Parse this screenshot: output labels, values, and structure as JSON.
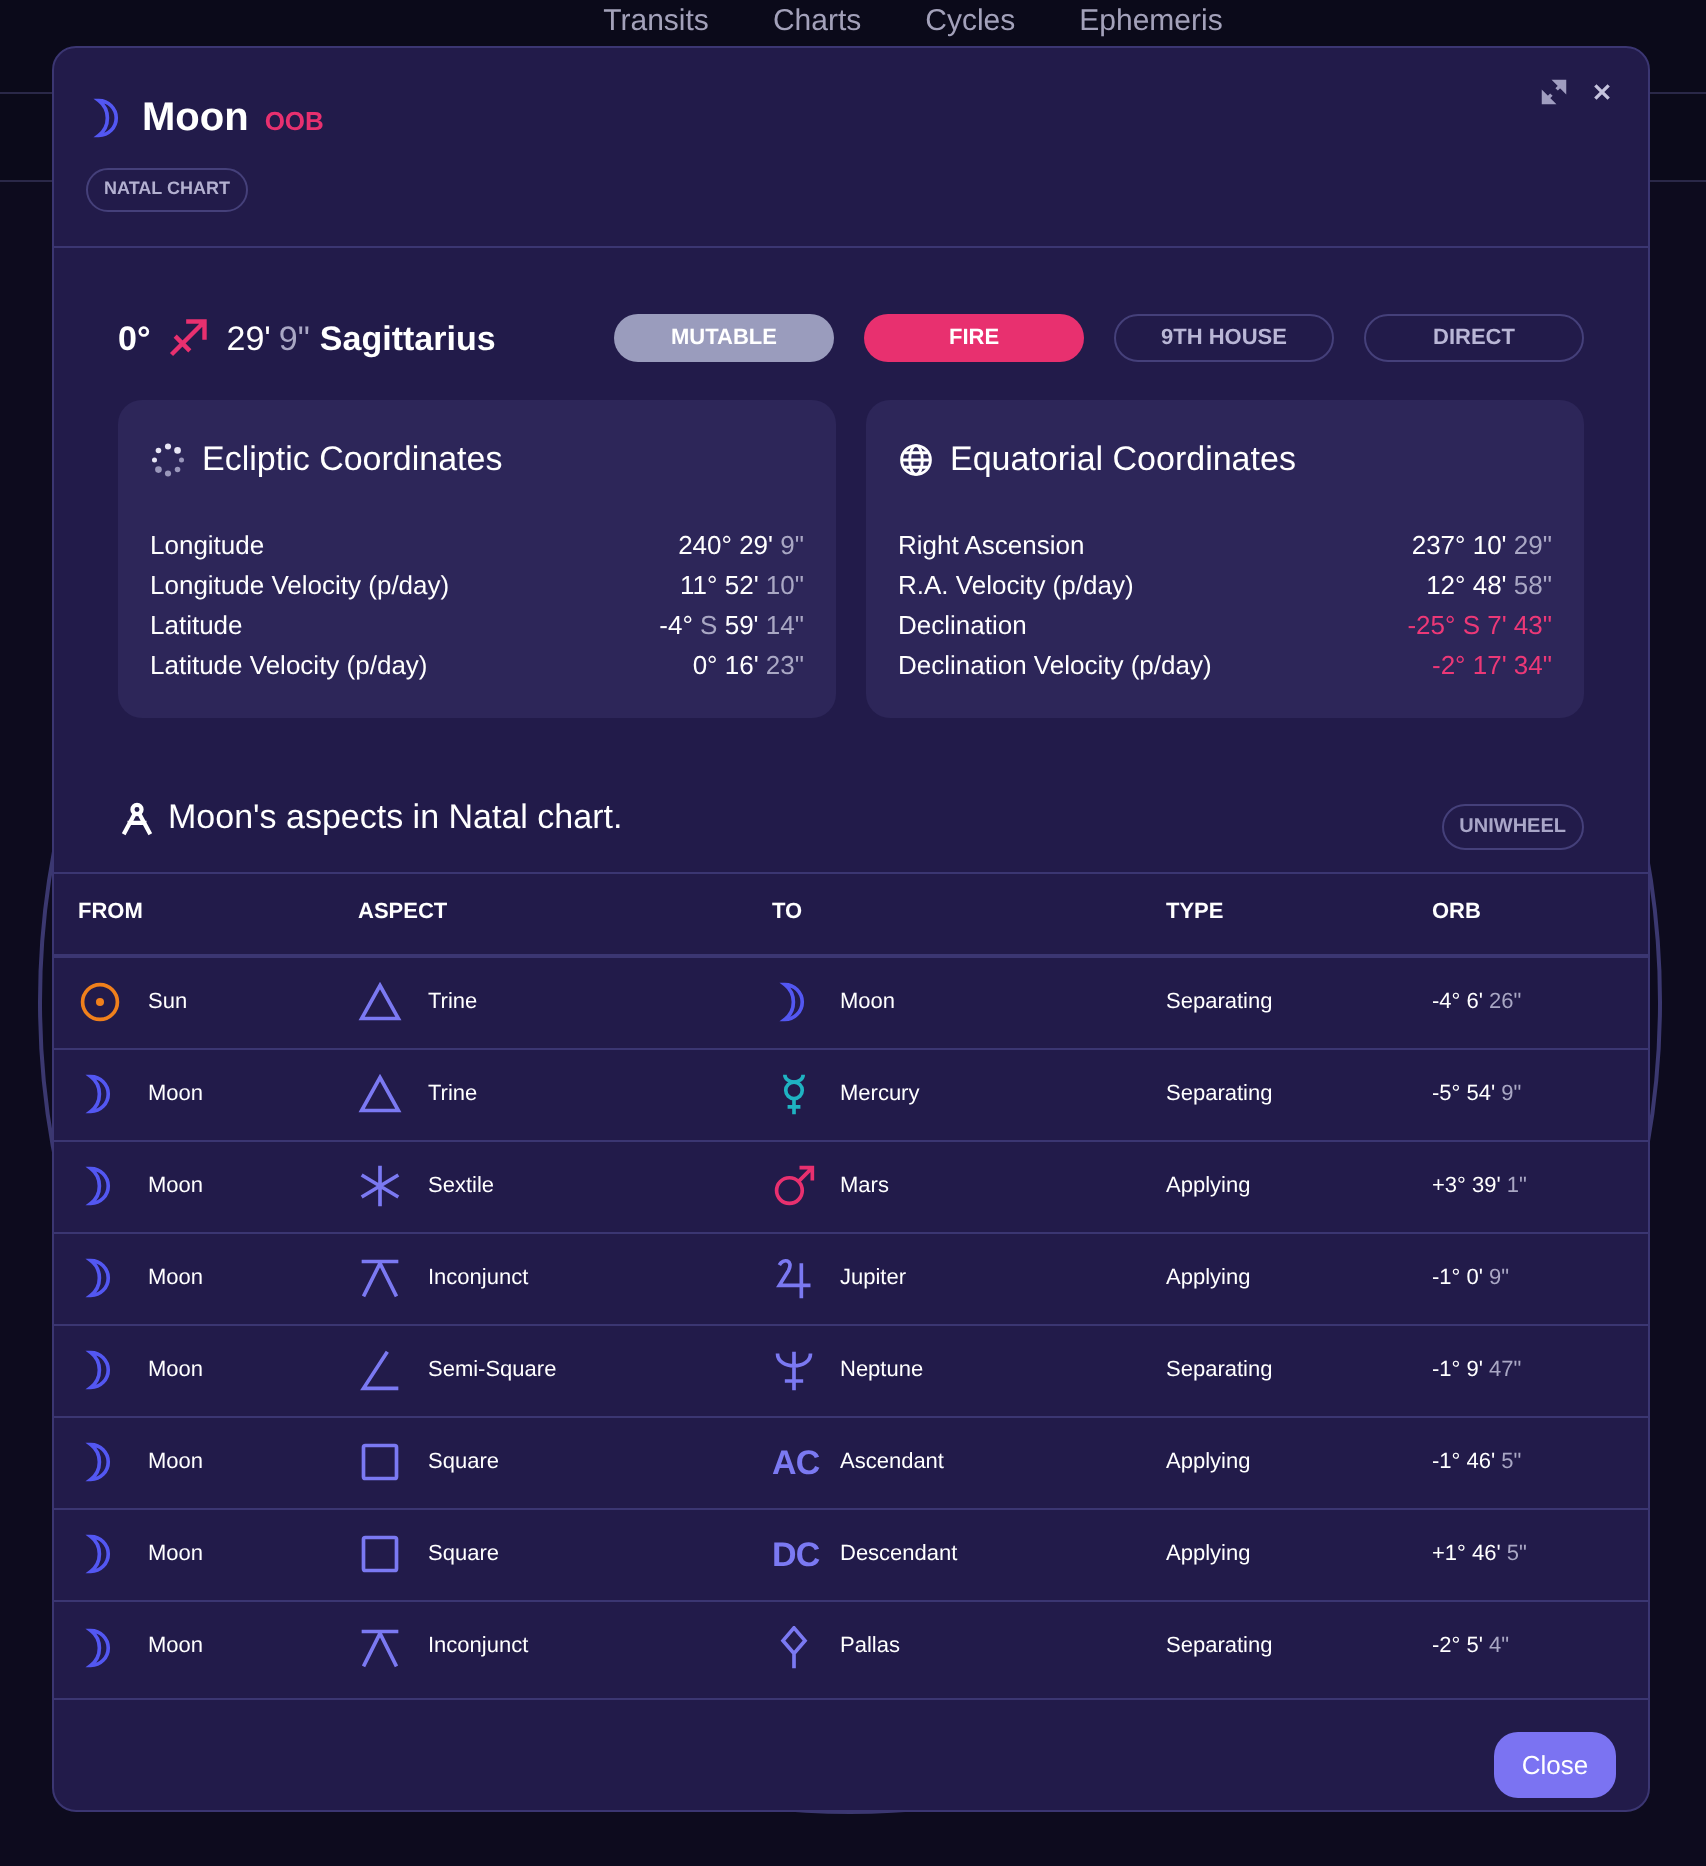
{
  "nav": [
    "Transits",
    "Charts",
    "Cycles",
    "Ephemeris"
  ],
  "dialog": {
    "title": "Moon",
    "flag": "OOB",
    "chart_badge": "NATAL CHART",
    "close_label": "Close"
  },
  "position": {
    "degree": "0°",
    "minutes": "29'",
    "seconds": "9\"",
    "sign": "Sagittarius"
  },
  "badges": [
    {
      "label": "MUTABLE",
      "kind": "filled",
      "color": "#9a9cbd"
    },
    {
      "label": "FIRE",
      "kind": "filled",
      "color": "#e8306f"
    },
    {
      "label": "9TH HOUSE",
      "kind": "outline"
    },
    {
      "label": "DIRECT",
      "kind": "outline"
    }
  ],
  "cards": [
    {
      "title": "Ecliptic Coordinates",
      "kind": "ecliptic",
      "rows": [
        {
          "label": "Longitude",
          "alert": false,
          "value": [
            {
              "t": "240° 29'",
              "dim": false
            },
            {
              "t": "9\"",
              "dim": true
            }
          ]
        },
        {
          "label": "Longitude Velocity (p/day)",
          "alert": false,
          "value": [
            {
              "t": "11° 52'",
              "dim": false
            },
            {
              "t": "10\"",
              "dim": true
            }
          ]
        },
        {
          "label": "Latitude",
          "alert": false,
          "value": [
            {
              "t": "-4°",
              "dim": false
            },
            {
              "t": "S",
              "dim": true
            },
            {
              "t": "59'",
              "dim": false
            },
            {
              "t": "14\"",
              "dim": true
            }
          ]
        },
        {
          "label": "Latitude Velocity (p/day)",
          "alert": false,
          "value": [
            {
              "t": "0° 16'",
              "dim": false
            },
            {
              "t": "23\"",
              "dim": true
            }
          ]
        }
      ]
    },
    {
      "title": "Equatorial Coordinates",
      "kind": "equatorial",
      "rows": [
        {
          "label": "Right Ascension",
          "alert": false,
          "value": [
            {
              "t": "237° 10'",
              "dim": false
            },
            {
              "t": "29\"",
              "dim": true
            }
          ]
        },
        {
          "label": "R.A. Velocity (p/day)",
          "alert": false,
          "value": [
            {
              "t": "12° 48'",
              "dim": false
            },
            {
              "t": "58\"",
              "dim": true
            }
          ]
        },
        {
          "label": "Declination",
          "alert": true,
          "value": [
            {
              "t": "-25° S 7' 43\""
            }
          ]
        },
        {
          "label": "Declination Velocity (p/day)",
          "alert": true,
          "value": [
            {
              "t": "-2° 17' 34\""
            }
          ]
        }
      ]
    }
  ],
  "aspects": {
    "title": "Moon's aspects in Natal chart.",
    "uniwheel": "UNIWHEEL",
    "columns": [
      "FROM",
      "ASPECT",
      "TO",
      "TYPE",
      "ORB"
    ],
    "rows": [
      {
        "from": {
          "kind": "sun",
          "name": "Sun"
        },
        "aspect": {
          "kind": "trine",
          "name": "Trine"
        },
        "to": {
          "kind": "moon",
          "name": "Moon"
        },
        "type": "Separating",
        "orb": "-4° 6'",
        "orb_seconds": "26\""
      },
      {
        "from": {
          "kind": "moon",
          "name": "Moon"
        },
        "aspect": {
          "kind": "trine",
          "name": "Trine"
        },
        "to": {
          "kind": "mercury",
          "name": "Mercury"
        },
        "type": "Separating",
        "orb": "-5° 54'",
        "orb_seconds": "9\""
      },
      {
        "from": {
          "kind": "moon",
          "name": "Moon"
        },
        "aspect": {
          "kind": "sextile",
          "name": "Sextile"
        },
        "to": {
          "kind": "mars",
          "name": "Mars"
        },
        "type": "Applying",
        "orb": "+3° 39'",
        "orb_seconds": "1\""
      },
      {
        "from": {
          "kind": "moon",
          "name": "Moon"
        },
        "aspect": {
          "kind": "inconjunct",
          "name": "Inconjunct"
        },
        "to": {
          "kind": "jupiter",
          "name": "Jupiter"
        },
        "type": "Applying",
        "orb": "-1° 0'",
        "orb_seconds": "9\""
      },
      {
        "from": {
          "kind": "moon",
          "name": "Moon"
        },
        "aspect": {
          "kind": "semisquare",
          "name": "Semi-Square"
        },
        "to": {
          "kind": "neptune",
          "name": "Neptune"
        },
        "type": "Separating",
        "orb": "-1° 9'",
        "orb_seconds": "47\""
      },
      {
        "from": {
          "kind": "moon",
          "name": "Moon"
        },
        "aspect": {
          "kind": "square",
          "name": "Square"
        },
        "to": {
          "kind": "text",
          "symbol": "AC",
          "name": "Ascendant"
        },
        "type": "Applying",
        "orb": "-1° 46'",
        "orb_seconds": "5\""
      },
      {
        "from": {
          "kind": "moon",
          "name": "Moon"
        },
        "aspect": {
          "kind": "square",
          "name": "Square"
        },
        "to": {
          "kind": "text",
          "symbol": "DC",
          "name": "Descendant"
        },
        "type": "Applying",
        "orb": "+1° 46'",
        "orb_seconds": "5\""
      },
      {
        "from": {
          "kind": "moon",
          "name": "Moon"
        },
        "aspect": {
          "kind": "inconjunct",
          "name": "Inconjunct"
        },
        "to": {
          "kind": "pallas",
          "name": "Pallas"
        },
        "type": "Separating",
        "orb": "-2° 5'",
        "orb_seconds": "4\""
      }
    ]
  }
}
